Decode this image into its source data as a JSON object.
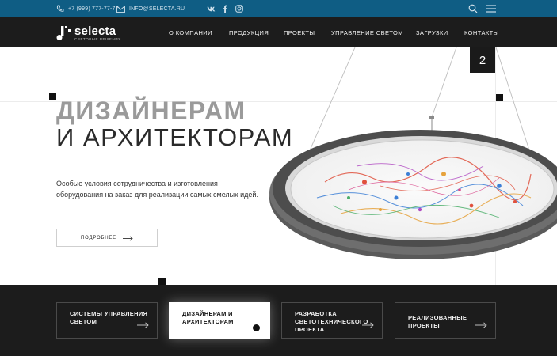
{
  "topbar": {
    "phone": "+7 (999) 777-77-77",
    "email": "INFO@SELECTA.RU",
    "social": [
      {
        "name": "vk-icon",
        "glyph": "vk"
      },
      {
        "name": "facebook-icon",
        "glyph": "f"
      },
      {
        "name": "instagram-icon",
        "glyph": "ig"
      }
    ]
  },
  "header": {
    "logo_name": "selecta",
    "logo_sub": "СВЕТОВЫЕ РЕШЕНИЯ",
    "nav": [
      "О КОМПАНИИ",
      "ПРОДУКЦИЯ",
      "ПРОЕКТЫ",
      "УПРАВЛЕНИЕ СВЕТОМ",
      "ЗАГРУЗКИ",
      "КОНТАКТЫ"
    ]
  },
  "hero": {
    "slide_number": "2",
    "title_line1": "ДИЗАЙНЕРАМ",
    "title_line2": "И АРХИТЕКТОРАМ",
    "description": "Особые условия сотрудничества и изготовления оборудования на заказ для реализации самых смелых идей.",
    "more_label": "ПОДРОБНЕЕ"
  },
  "tiles": [
    {
      "label": "СИСТЕМЫ УПРАВЛЕНИЯ СВЕТОМ",
      "active": false
    },
    {
      "label": "ДИЗАЙНЕРАМ И АРХИТЕКТОРАМ",
      "active": true
    },
    {
      "label": "РАЗРАБОТКА СВЕТОТЕХНИЧЕСКОГО ПРОЕКТА",
      "active": false
    },
    {
      "label": "РЕАЛИЗОВАННЫЕ ПРОЕКТЫ",
      "active": false
    }
  ],
  "colors": {
    "topbar": "#0f5d84",
    "navbar": "#1c1c1c",
    "title_grey": "#9a9a9a"
  }
}
